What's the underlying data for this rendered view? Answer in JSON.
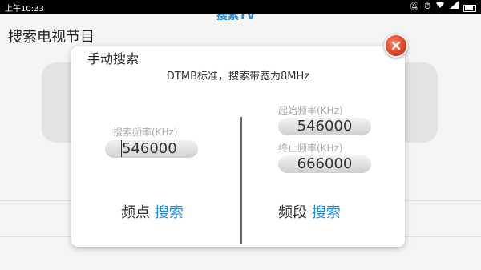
{
  "status_bar": {
    "time": "上午10:33",
    "icons": [
      "silent-icon",
      "alarm-icon",
      "wifi-icon",
      "signal-icon",
      "battery-icon"
    ]
  },
  "app": {
    "title": "搜索电视节目",
    "header_partial": "搜索TV"
  },
  "dialog": {
    "title": "手动搜索",
    "subtitle": "DTMB标准，搜索带宽为8MHz",
    "left": {
      "freq_label": "搜索频率(KHz)",
      "freq_value": "546000",
      "action_prefix": "频点",
      "action_link": "搜索"
    },
    "right": {
      "start_label": "起始频率(KHz)",
      "start_value": "546000",
      "end_label": "终止频率(KHz)",
      "end_value": "666000",
      "action_prefix": "频段",
      "action_link": "搜索"
    }
  },
  "colors": {
    "accent": "#1e88e5",
    "close": "#d43b1f"
  }
}
